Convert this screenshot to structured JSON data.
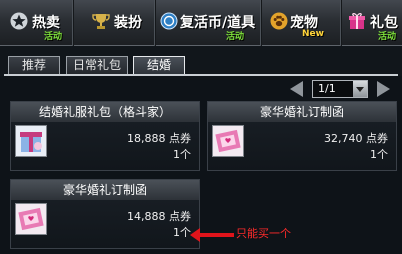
{
  "categories": [
    {
      "label": "热卖",
      "sub": "活动",
      "icon": "star-icon"
    },
    {
      "label": "装扮",
      "sub": "",
      "icon": "trophy-icon"
    },
    {
      "label": "复活币/道具",
      "sub": "活动",
      "icon": "coin-icon"
    },
    {
      "label": "宠物",
      "sub": "New",
      "icon": "paw-icon"
    },
    {
      "label": "礼包",
      "sub": "活动",
      "icon": "gift-icon"
    }
  ],
  "tabs": [
    {
      "label": "推荐"
    },
    {
      "label": "日常礼包"
    },
    {
      "label": "结婚",
      "active": true
    }
  ],
  "pager": {
    "value": "1/1"
  },
  "products": [
    {
      "title": "结婚礼服礼包（格斗家）",
      "price": "18,888 点券",
      "qty": "1个",
      "icon": "gift-box-icon"
    },
    {
      "title": "豪华婚礼订制函",
      "price": "32,740 点券",
      "qty": "1个",
      "icon": "invitation-card-icon"
    },
    {
      "title": "豪华婚礼订制函",
      "price": "14,888 点券",
      "qty": "1个",
      "icon": "invitation-card-icon"
    }
  ],
  "annotation": {
    "text": "只能买一个",
    "color": "#ff2a2a"
  }
}
